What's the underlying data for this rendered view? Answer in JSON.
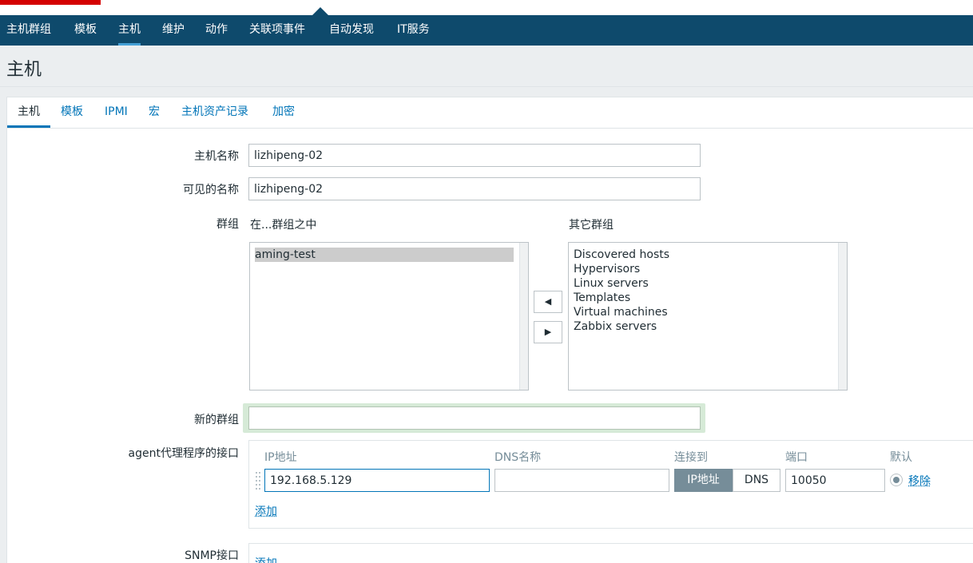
{
  "nav": {
    "items": [
      "主机群组",
      "模板",
      "主机",
      "维护",
      "动作",
      "关联项事件",
      "自动发现",
      "IT服务"
    ],
    "active_index": 2
  },
  "page": {
    "title": "主机"
  },
  "tabs": [
    "主机",
    "模板",
    "IPMI",
    "宏",
    "主机资产记录",
    "加密"
  ],
  "form": {
    "host_name": {
      "label": "主机名称",
      "value": "lizhipeng-02"
    },
    "visible_name": {
      "label": "可见的名称",
      "value": "lizhipeng-02"
    },
    "groups": {
      "label": "群组",
      "in_groups_title": "在...群组之中",
      "other_groups_title": "其它群组",
      "in_groups": [
        "aming-test"
      ],
      "selected_in_group": "aming-test",
      "other_groups": [
        "Discovered hosts",
        "Hypervisors",
        "Linux servers",
        "Templates",
        "Virtual machines",
        "Zabbix servers"
      ],
      "move_left_icon": "triangle-left-icon",
      "move_right_icon": "triangle-right-icon"
    },
    "new_group": {
      "label": "新的群组",
      "value": ""
    },
    "agent_interfaces": {
      "label": "agent代理程序的接口",
      "columns": {
        "ip": "IP地址",
        "dns": "DNS名称",
        "connect_to": "连接到",
        "port": "端口",
        "default": "默认"
      },
      "row": {
        "ip": "192.168.5.129",
        "dns": "",
        "connect_options": [
          "IP地址",
          "DNS"
        ],
        "connect_selected": "IP地址",
        "port": "10050",
        "is_default": true,
        "remove_label": "移除"
      },
      "add_label": "添加"
    },
    "snmp_interfaces": {
      "label": "SNMP接口",
      "add_label": "添加"
    }
  }
}
